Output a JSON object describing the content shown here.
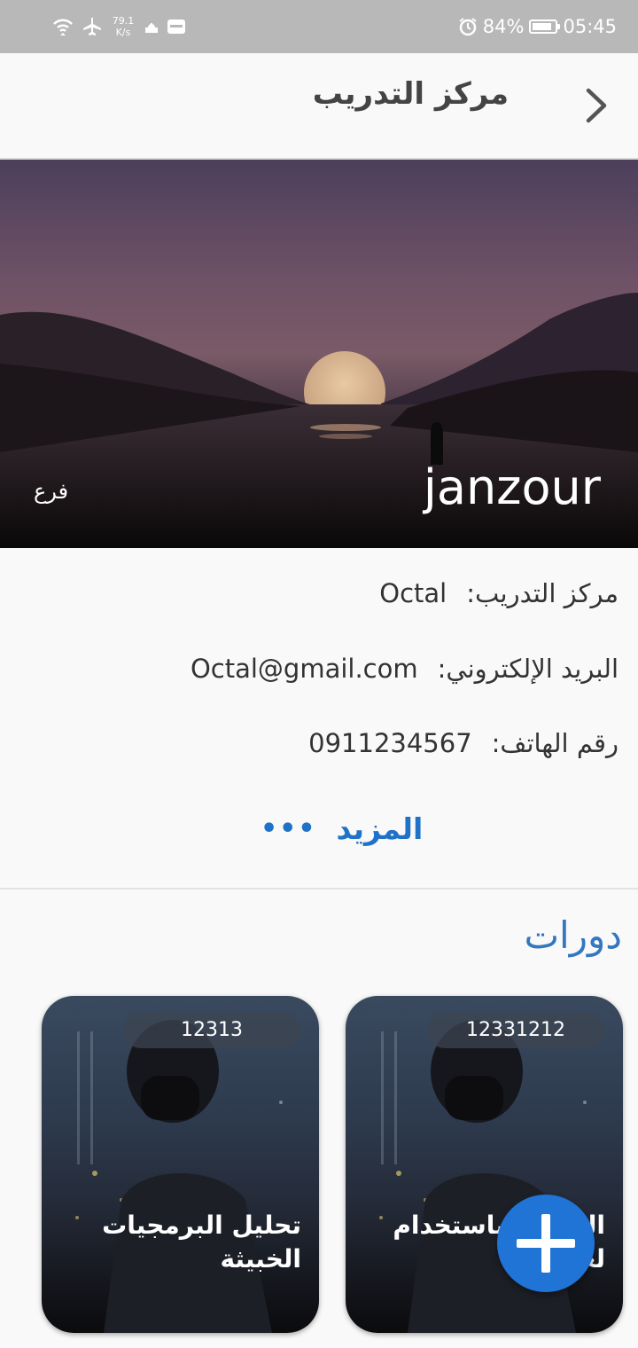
{
  "status_bar": {
    "speed_value": "79.1",
    "speed_unit": "K/s",
    "battery": "84%",
    "battery_level": 0.84,
    "time": "05:45"
  },
  "header": {
    "title": "مركز التدريب"
  },
  "hero": {
    "branch_name": "janzour",
    "branch_label": "فرع"
  },
  "info": {
    "center_label": "مركز التدريب:",
    "center_value": "Octal",
    "email_label": "البريد الإلكتروني:",
    "email_value": "Octal@gmail.com",
    "phone_label": "رقم الهاتف:",
    "phone_value": "0911234567"
  },
  "more": {
    "label": "المزيد",
    "dots": "•••"
  },
  "courses": {
    "title": "دورات",
    "items": [
      {
        "id": "12331212",
        "title": "البرمجة باستخدام لغة جافا"
      },
      {
        "id": "12313",
        "title": "تحليل البرمجيات الخبيثة"
      }
    ]
  },
  "colors": {
    "accent": "#1f72c8",
    "fab": "#1f74d6"
  }
}
